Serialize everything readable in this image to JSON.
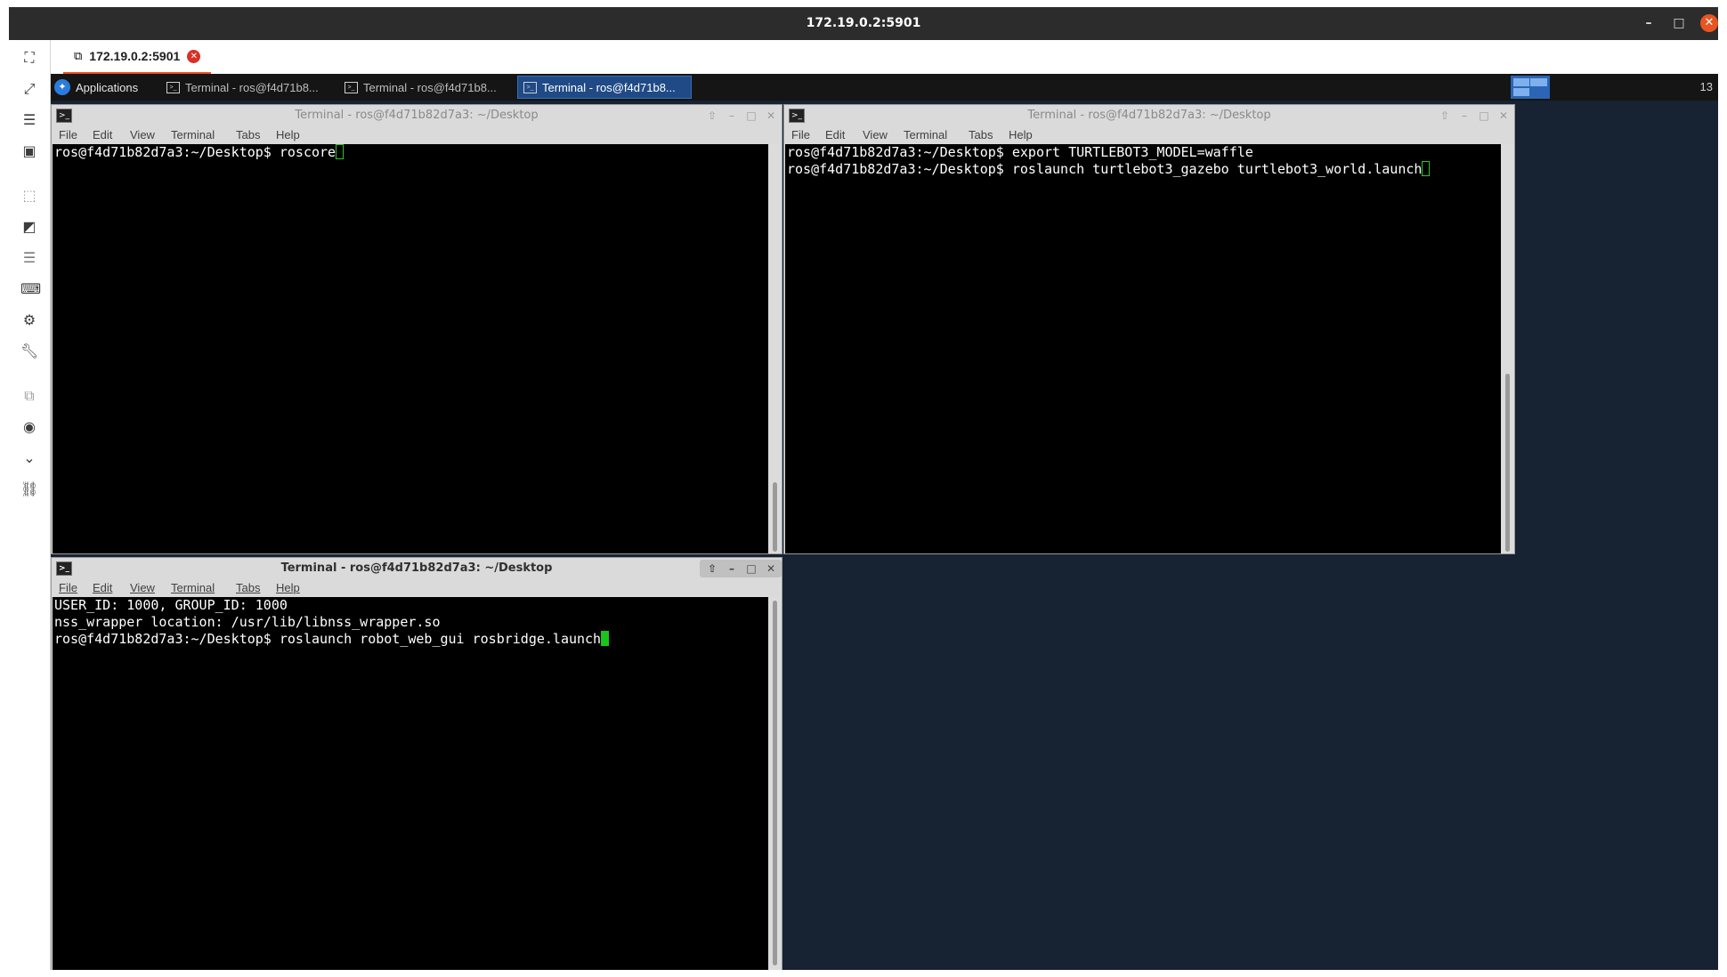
{
  "outer_window": {
    "title": "172.19.0.2:5901",
    "tab_label": "172.19.0.2:5901"
  },
  "panel": {
    "applications_label": "Applications",
    "tasks": [
      "Terminal - ros@f4d71b8...",
      "Terminal - ros@f4d71b8...",
      "Terminal - ros@f4d71b8..."
    ],
    "clock": "13"
  },
  "terminal_menu": [
    "File",
    "Edit",
    "View",
    "Terminal",
    "Tabs",
    "Help"
  ],
  "terminals": {
    "top_left": {
      "title": "Terminal - ros@f4d71b82d7a3: ~/Desktop",
      "lines": [
        "ros@f4d71b82d7a3:~/Desktop$ roscore"
      ]
    },
    "top_right": {
      "title": "Terminal - ros@f4d71b82d7a3: ~/Desktop",
      "lines": [
        "ros@f4d71b82d7a3:~/Desktop$ export TURTLEBOT3_MODEL=waffle",
        "ros@f4d71b82d7a3:~/Desktop$ roslaunch turtlebot3_gazebo turtlebot3_world.launch"
      ]
    },
    "bottom_left": {
      "title": "Terminal - ros@f4d71b82d7a3: ~/Desktop",
      "lines": [
        "USER_ID: 1000, GROUP_ID: 1000",
        "nss_wrapper location: /usr/lib/libnss_wrapper.so",
        "ros@f4d71b82d7a3:~/Desktop$ roslaunch robot_web_gui rosbridge.launch"
      ]
    }
  },
  "colors": {
    "desktop_background": "#172232",
    "panel_background": "#151515",
    "active_task": "#1f4a86",
    "cursor_green": "#19c519",
    "accent_orange": "#e95420"
  },
  "icons": {
    "toolbar": [
      "fit-screen-icon",
      "fullscreen-icon",
      "menu-icon",
      "window-icon",
      "scale-icon",
      "expand-icon",
      "list-icon",
      "keyboard-icon",
      "settings-icon",
      "wrench-icon",
      "copy-icon",
      "screenshot-icon",
      "chevron-down-icon",
      "link-icon"
    ]
  }
}
